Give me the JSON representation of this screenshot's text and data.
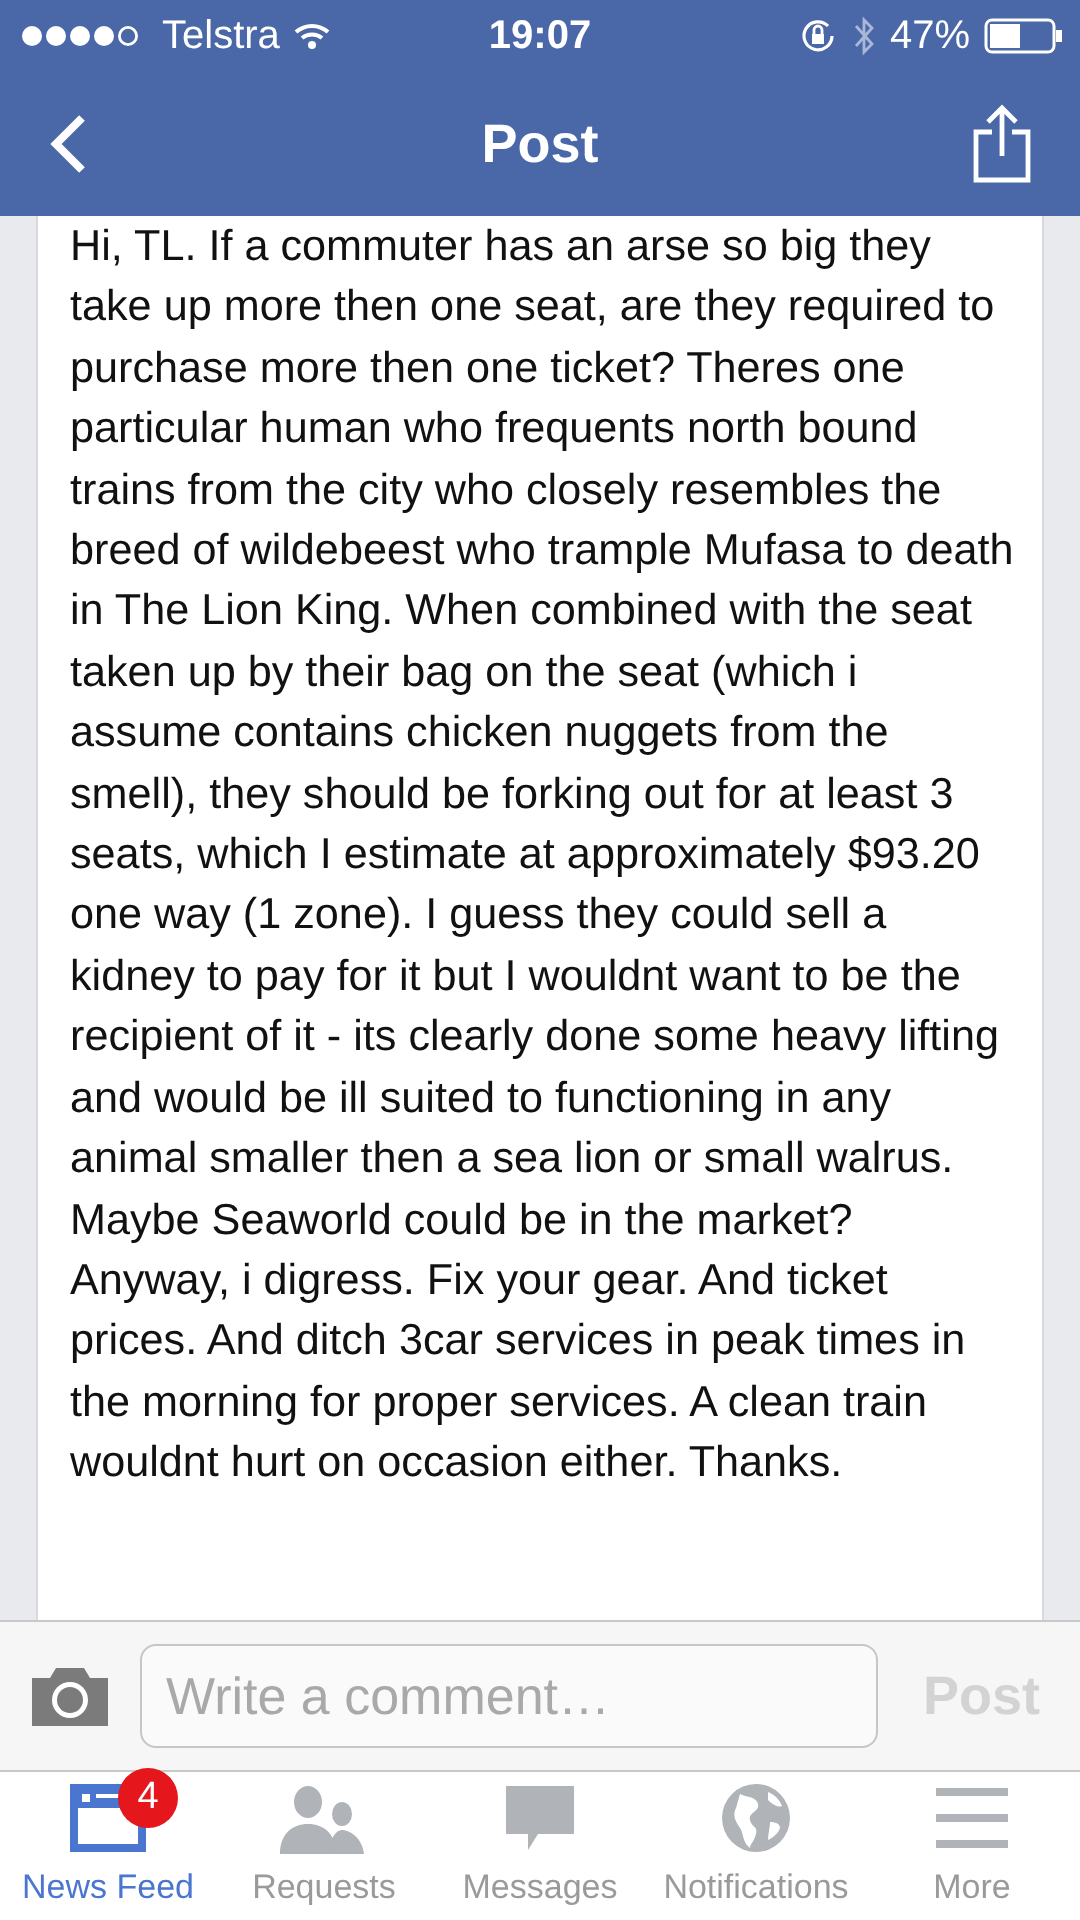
{
  "status_bar": {
    "carrier": "Telstra",
    "time": "19:07",
    "battery": "47%"
  },
  "nav": {
    "title": "Post"
  },
  "post": {
    "text": "Hi, TL. If a commuter has an arse so big they take up more then one seat, are they required to purchase more then one ticket? Theres one particular human who frequents north bound trains from the city who closely resembles the breed of wildebeest who trample Mufasa to death in The Lion King. When combined with the seat taken up by their bag on the seat (which i assume contains chicken nuggets from the smell), they should be forking out for at least 3 seats, which I estimate at approximately $93.20 one way (1 zone). I guess they could sell a kidney to pay for it but I wouldnt want to be the recipient of it - its clearly done some heavy lifting and would be ill suited to functioning in any animal smaller then a sea lion or small walrus. Maybe Seaworld could be in the market? Anyway, i digress. Fix your gear. And ticket prices. And ditch 3car services in peak times in the morning for proper services. A clean train wouldnt hurt on occasion either. Thanks."
  },
  "comment_bar": {
    "placeholder": "Write a comment…",
    "post_button": "Post",
    "post_disabled": true
  },
  "tabs": [
    {
      "kind": "feed",
      "label": "News Feed",
      "selected": true,
      "badge": "4"
    },
    {
      "kind": "requests",
      "label": "Requests",
      "selected": false
    },
    {
      "kind": "messages",
      "label": "Messages",
      "selected": false
    },
    {
      "kind": "notifications",
      "label": "Notifications",
      "selected": false
    },
    {
      "kind": "more",
      "label": "More",
      "selected": false
    }
  ]
}
